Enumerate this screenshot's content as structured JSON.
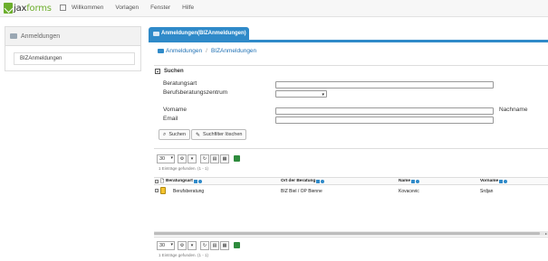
{
  "app": {
    "logo_prefix": "jax",
    "logo_brand": "forms"
  },
  "nav": {
    "items": [
      "Willkommen",
      "Vorlagen",
      "Fenster",
      "Hilfe"
    ]
  },
  "left_panel": {
    "title": "Anmeldungen",
    "item": "BIZAnmeldungen"
  },
  "tab": {
    "label": "Anmeldungen(BIZAnmeldungen)"
  },
  "breadcrumb": {
    "first": "Anmeldungen",
    "separator": "/",
    "second": "BIZAnmeldungen"
  },
  "search": {
    "title": "Suchen",
    "beratungsart_label": "Beratungsart",
    "beratungsart_value": "",
    "zentrum_label": "Berufsberatungszentrum",
    "zentrum_value": "",
    "vorname_label": "Vorname",
    "vorname_value": "",
    "nachname_label": "Nachname",
    "email_label": "Email",
    "email_value": "",
    "search_button": "Suchen",
    "clear_button": "Suchfilter löschen"
  },
  "grid": {
    "page_size": "30",
    "count_text_top": "1 Einträge gefunden. (1 - 1)",
    "count_text_bottom": "1 Einträge gefunden. (1 - 1)",
    "columns": [
      "Beratungsart",
      "Ort der Beratung",
      "Name",
      "Vorname"
    ],
    "rows": [
      {
        "beratungsart": "Berufsberatung",
        "ort": "BIZ Biel / OP Bienne",
        "name": "Kovacevic",
        "vorname": "Srdjan"
      }
    ]
  },
  "colors": {
    "accent": "#2f8ac9",
    "brand": "#6cae2c"
  }
}
